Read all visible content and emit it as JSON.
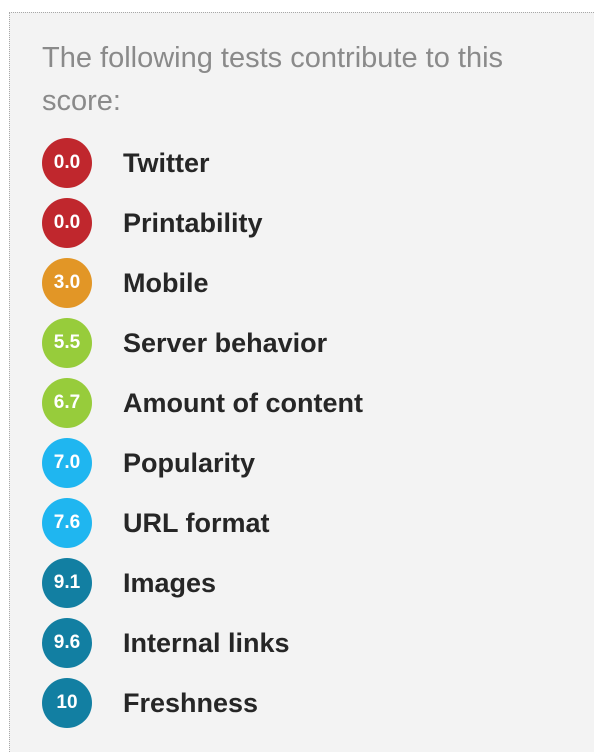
{
  "intro_text": "The following tests contribute to this score:",
  "colors": {
    "red": "#c0272d",
    "orange": "#e29626",
    "light_green": "#97cc3b",
    "light_blue": "#1fb6f0",
    "teal": "#127fa2"
  },
  "tests": [
    {
      "score": "0.0",
      "label": "Twitter",
      "color": "#c0272d"
    },
    {
      "score": "0.0",
      "label": "Printability",
      "color": "#c0272d"
    },
    {
      "score": "3.0",
      "label": "Mobile",
      "color": "#e29626"
    },
    {
      "score": "5.5",
      "label": "Server behavior",
      "color": "#97cc3b"
    },
    {
      "score": "6.7",
      "label": "Amount of content",
      "color": "#97cc3b"
    },
    {
      "score": "7.0",
      "label": "Popularity",
      "color": "#1fb6f0"
    },
    {
      "score": "7.6",
      "label": "URL format",
      "color": "#1fb6f0"
    },
    {
      "score": "9.1",
      "label": "Images",
      "color": "#127fa2"
    },
    {
      "score": "9.6",
      "label": "Internal links",
      "color": "#127fa2"
    },
    {
      "score": "10",
      "label": "Freshness",
      "color": "#127fa2"
    }
  ]
}
